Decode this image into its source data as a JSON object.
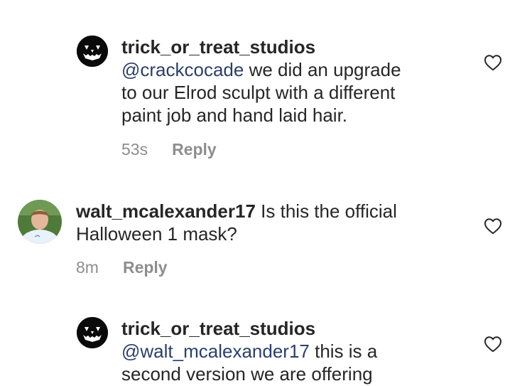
{
  "comments": [
    {
      "username": "trick_or_treat_studios",
      "mention": "@crackcocade",
      "lines_after_mention": " we did an upgrade",
      "line2": "to our Elrod sculpt with a different",
      "line3": "paint job and hand laid hair.",
      "time": "53s",
      "reply_label": "Reply",
      "avatar_icon": "jack-o-lantern-icon",
      "like_icon": "heart-outline-icon"
    },
    {
      "username": "walt_mcalexander17",
      "line1_after_username": " Is this the official",
      "line2": "Halloween 1 mask?",
      "time": "8m",
      "reply_label": "Reply",
      "avatar_icon": "user-photo-avatar",
      "like_icon": "heart-outline-icon"
    },
    {
      "username": "trick_or_treat_studios",
      "mention": "@walt_mcalexander17",
      "lines_after_mention": " this is a",
      "line2": "second version we are offering",
      "avatar_icon": "jack-o-lantern-icon",
      "like_icon": "heart-outline-icon"
    }
  ],
  "colors": {
    "text": "#262626",
    "mention": "#2b3f6b",
    "meta": "#8e8e8e",
    "avatar_bg": "#0a0a0a"
  }
}
